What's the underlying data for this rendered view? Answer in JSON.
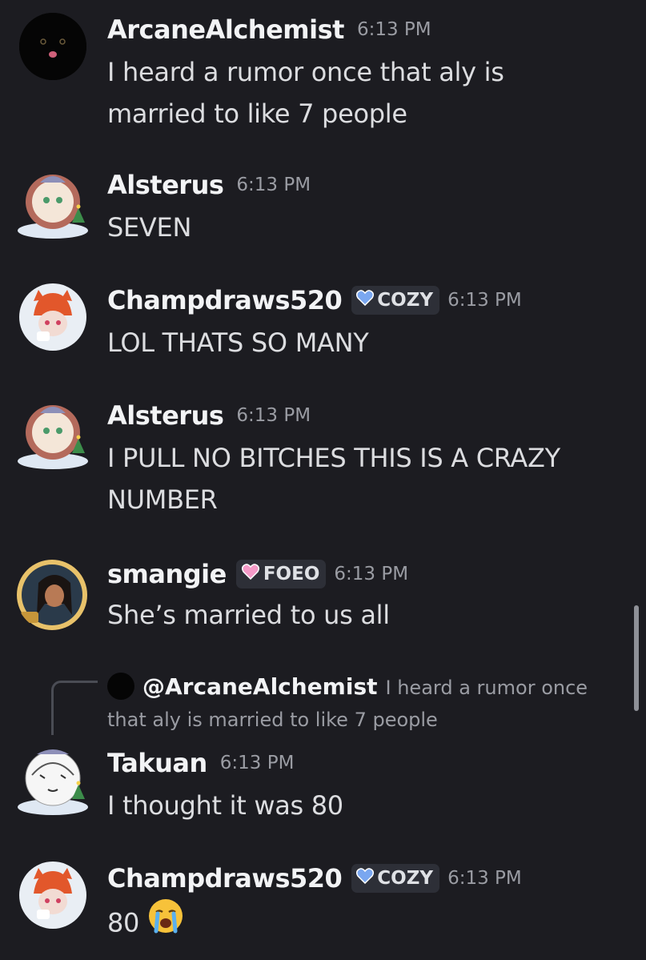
{
  "messages": [
    {
      "author": "ArcaneAlchemist",
      "time": "6:13 PM",
      "lines": [
        "I heard a rumor once that aly is",
        "married to like 7 people"
      ]
    },
    {
      "author": "Alsterus",
      "time": "6:13 PM",
      "lines": [
        "SEVEN"
      ]
    },
    {
      "author": "Champdraws520",
      "tag": "COZY",
      "time": "6:13 PM",
      "lines": [
        "LOL THATS SO MANY"
      ]
    },
    {
      "author": "Alsterus",
      "time": "6:13 PM",
      "lines": [
        "I PULL NO BITCHES THIS IS A CRAZY",
        "NUMBER"
      ]
    },
    {
      "author": "smangie",
      "tag": "FOEO",
      "time": "6:13 PM",
      "lines": [
        "She’s married to us all"
      ]
    },
    {
      "author": "Takuan",
      "time": "6:13 PM",
      "lines": [
        "I thought it was 80"
      ],
      "reply": {
        "mention": "@ArcaneAlchemist",
        "preview_line1": "I heard a rumor once",
        "preview_line2": "that aly is married to like 7 people"
      }
    },
    {
      "author": "Champdraws520",
      "tag": "COZY",
      "time": "6:13 PM",
      "lines": [
        "80"
      ],
      "emoji": "loudly-crying-face"
    }
  ],
  "colors": {
    "background": "#1c1c21",
    "cozy_heart": "#7aa7f0",
    "foeo_heart": "#f59ac8",
    "text": "#dcdde0",
    "muted": "#9a9ca3"
  }
}
